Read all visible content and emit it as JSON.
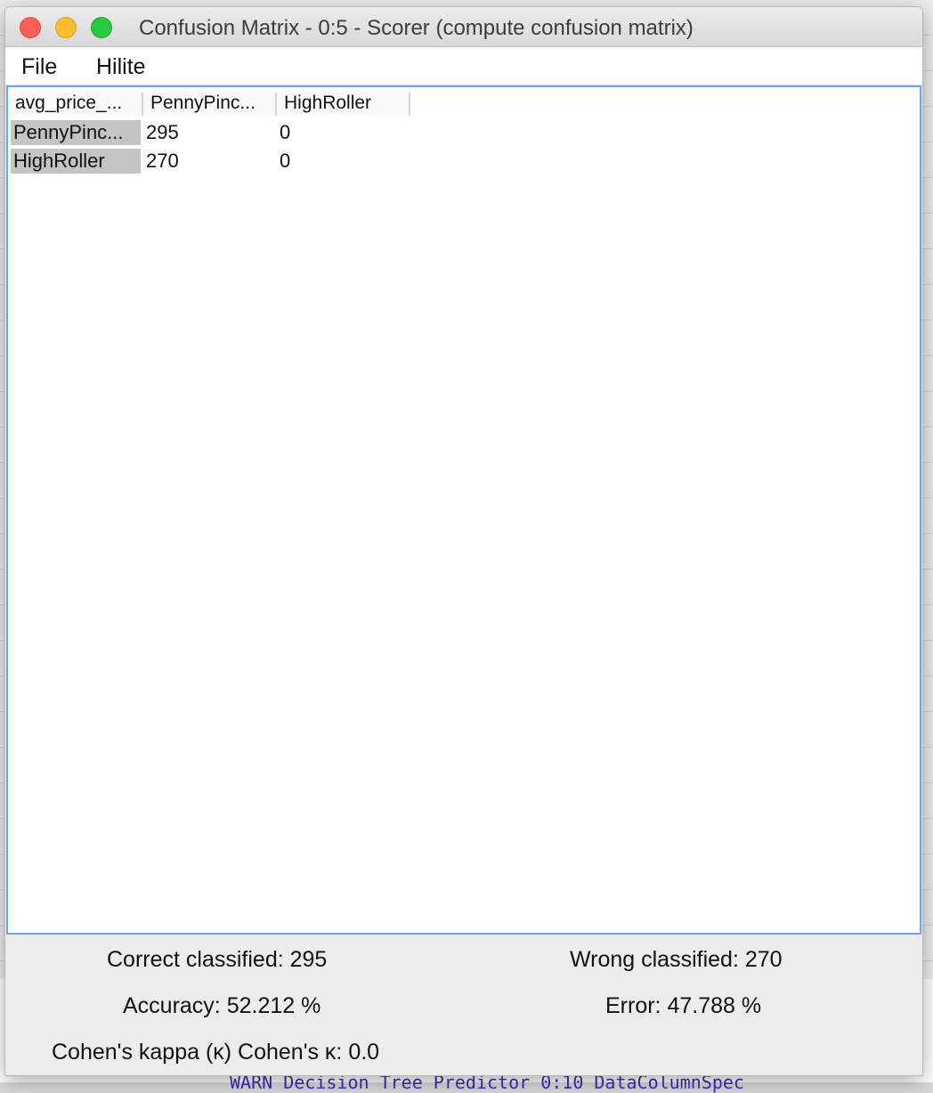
{
  "window": {
    "title": "Confusion Matrix - 0:5 - Scorer (compute confusion matrix)"
  },
  "menu": {
    "items": [
      {
        "label": "File"
      },
      {
        "label": "Hilite"
      }
    ]
  },
  "table": {
    "columns": [
      "avg_price_...",
      "PennyPinc...",
      "HighRoller"
    ],
    "rows": [
      {
        "label": "PennyPinc...",
        "values": [
          "295",
          "0"
        ]
      },
      {
        "label": "HighRoller",
        "values": [
          "270",
          "0"
        ]
      }
    ]
  },
  "stats": {
    "correct_classified": "Correct classified: 295",
    "wrong_classified": "Wrong classified: 270",
    "accuracy": "Accuracy: 52.212 %",
    "error": "Error: 47.788 %",
    "cohens_kappa": "Cohen's kappa (κ) Cohen's κ: 0.0"
  },
  "background": {
    "console_line": "WARN  Decision Tree Predictor 0:10      DataColumnSpec"
  },
  "colors": {
    "selection_border": "#6aa9e6",
    "row_header_bg": "#c4c4c4",
    "close": "#fc5f57",
    "minimize": "#fdbc2e",
    "zoom": "#28c840"
  }
}
